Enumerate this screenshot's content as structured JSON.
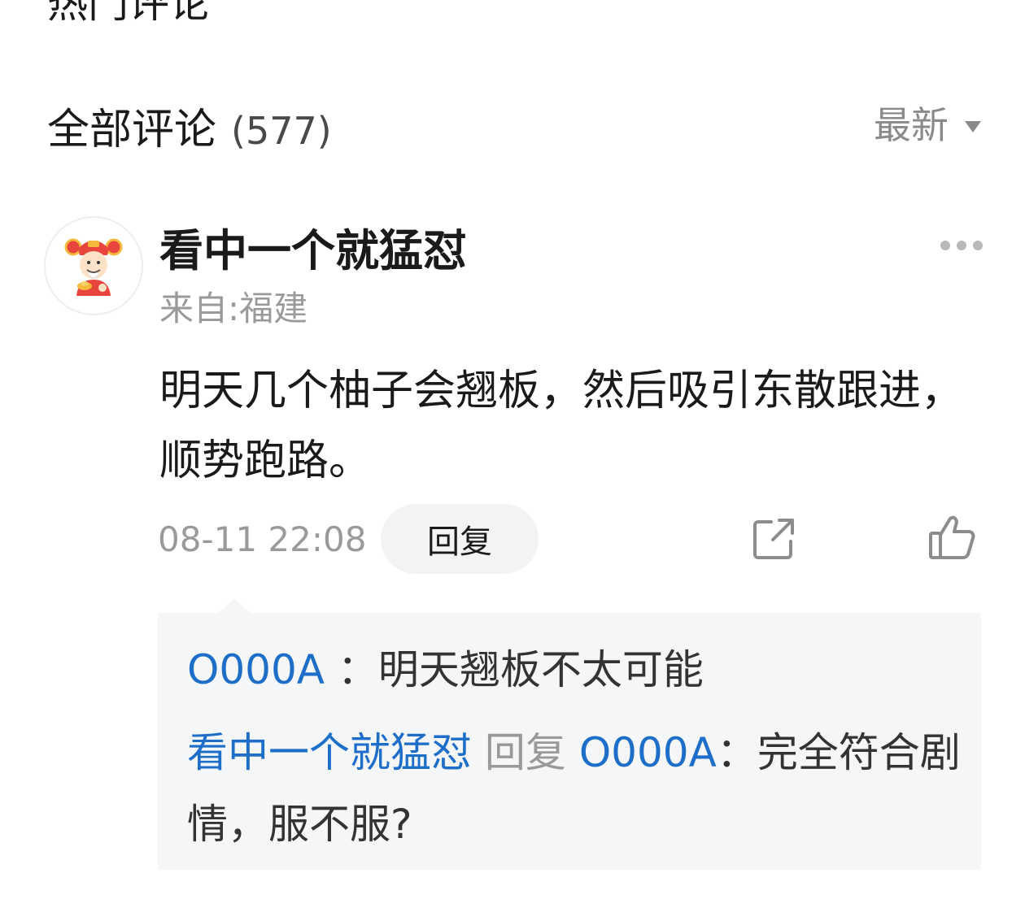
{
  "hot_section": {
    "title": "热门评论"
  },
  "all_section": {
    "title": "全部评论",
    "count": "(577)",
    "sort_label": "最新"
  },
  "comment": {
    "username": "看中一个就猛怼",
    "location": "来自:福建",
    "text": "明天几个柚子会翘板，然后吸引东散跟进，顺势跑路。",
    "timestamp": "08-11 22:08",
    "reply_label": "回复",
    "icons": {
      "share": "share-icon",
      "like": "thumbs-up-icon",
      "more": "more-dots-icon",
      "avatar": "god-of-wealth-avatar"
    }
  },
  "replies": [
    {
      "author": "O000A",
      "separator": " ：",
      "text": "明天翘板不太可能"
    },
    {
      "author": "看中一个就猛怼",
      "reply_word": "回复",
      "target": "O000A",
      "separator": "：",
      "text": "完全符合剧情，服不服?"
    }
  ],
  "colors": {
    "link_blue": "#1d6ec9",
    "muted_gray": "#9a9a9a",
    "reply_bg": "#f5f6f8"
  }
}
